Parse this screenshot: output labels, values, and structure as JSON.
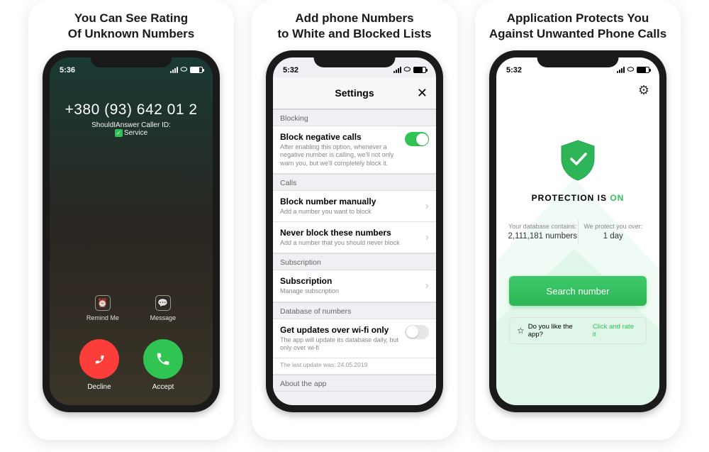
{
  "card1": {
    "title_l1": "You Can See Rating",
    "title_l2": "Of Unknown Numbers",
    "time": "5:36",
    "phone_number": "+380 (93) 642 01 2",
    "caller_id_label": "ShouldIAnswer Caller ID:",
    "caller_tag": "Service",
    "remind": "Remind Me",
    "message": "Message",
    "decline": "Decline",
    "accept": "Accept"
  },
  "card2": {
    "title_l1": "Add phone Numbers",
    "title_l2": "to White and Blocked Lists",
    "time": "5:32",
    "header": "Settings",
    "sec_blocking": "Blocking",
    "block_neg_t": "Block negative calls",
    "block_neg_d": "After enabling this option, whenever a negative number is calling, we'll not only warn you, but we'll completely block it.",
    "sec_calls": "Calls",
    "manual_t": "Block number manually",
    "manual_d": "Add a number you want to block",
    "never_t": "Never block these numbers",
    "never_d": "Add a number that you should never block",
    "sec_sub": "Subscription",
    "sub_t": "Subscription",
    "sub_d": "Manage subscription",
    "sec_db": "Database of numbers",
    "wifi_t": "Get updates over wi-fi only",
    "wifi_d": "The app will update its database daily, but only over wi-fi",
    "last_update": "The last update was: 24.05.2019",
    "sec_about": "About the app"
  },
  "card3": {
    "title_l1": "Application Protects You",
    "title_l2": "Against Unwanted Phone Calls",
    "time": "5:32",
    "prot_label": "PROTECTION IS ",
    "prot_state": "ON",
    "stat1_l": "Your database contains:",
    "stat1_v": "2,111,181 numbers",
    "stat2_l": "We protect you over:",
    "stat2_v": "1 day",
    "search_btn": "Search number",
    "rate_q": "Do you like the app?",
    "rate_link": "Click and rate it"
  }
}
